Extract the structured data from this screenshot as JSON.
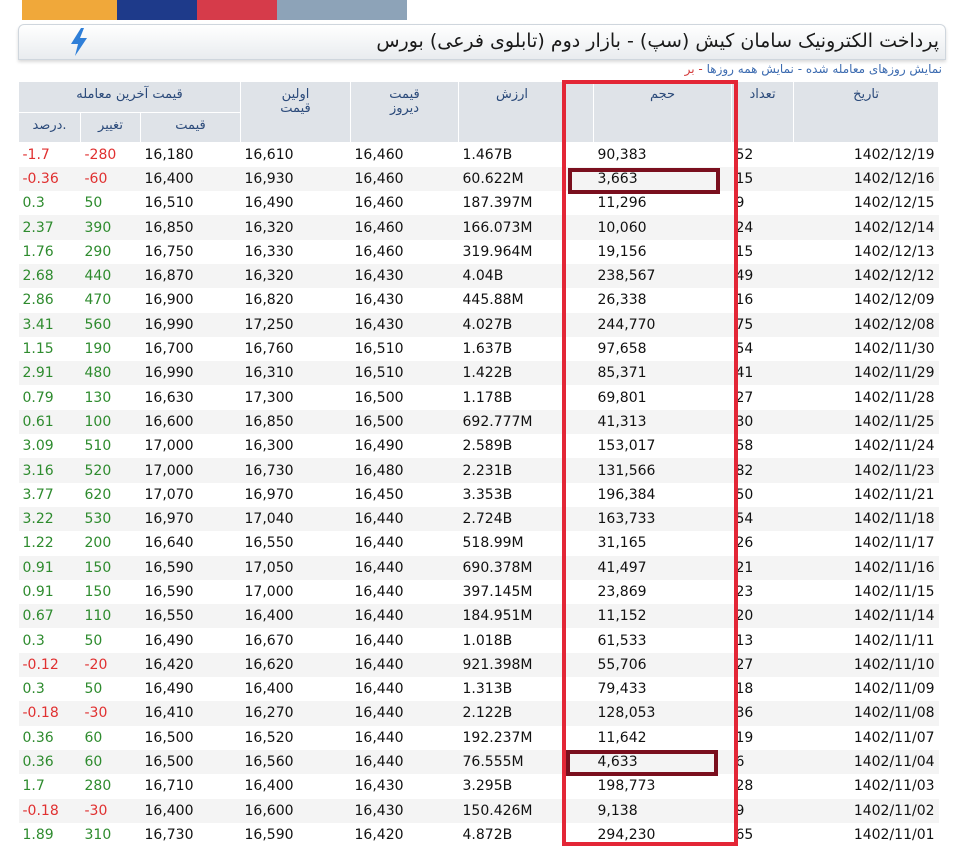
{
  "title": "پرداخت الکترونیک سامان کیش (سپ) - بازار دوم (تابلوی فرعی) بورس",
  "links": {
    "trade_days": "نمایش روزهای معامله شده",
    "separator": "-",
    "all_days": "نمایش همه روزها",
    "cut": "- بر"
  },
  "headers": {
    "date": "تاریخ",
    "count": "تعداد",
    "volume": "حجم",
    "value": "ارزش",
    "yesterday": "قیمت دیروز",
    "first": "اولین قیمت",
    "last_trade": "قیمت آخرین معامله",
    "price": "قیمت",
    "change": "تغییر",
    "percent": "درصد."
  },
  "colors": {
    "positive": "#2e8b2e",
    "negative": "#e03030",
    "highlight_frame": "#e32636",
    "highlight_box": "#7a0f1e"
  },
  "rows": [
    {
      "pct": "-1.7",
      "chg": "-280",
      "price": "16,180",
      "first": "16,610",
      "yest": "16,460",
      "val": "1.467B",
      "vol": "90,383",
      "cnt": "52",
      "date": "1402/12/19"
    },
    {
      "pct": "-0.36",
      "chg": "-60",
      "price": "16,400",
      "first": "16,930",
      "yest": "16,460",
      "val": "60.622M",
      "vol": "3,663",
      "cnt": "15",
      "date": "1402/12/16"
    },
    {
      "pct": "0.3",
      "chg": "50",
      "price": "16,510",
      "first": "16,490",
      "yest": "16,460",
      "val": "187.397M",
      "vol": "11,296",
      "cnt": "9",
      "date": "1402/12/15"
    },
    {
      "pct": "2.37",
      "chg": "390",
      "price": "16,850",
      "first": "16,320",
      "yest": "16,460",
      "val": "166.073M",
      "vol": "10,060",
      "cnt": "24",
      "date": "1402/12/14"
    },
    {
      "pct": "1.76",
      "chg": "290",
      "price": "16,750",
      "first": "16,330",
      "yest": "16,460",
      "val": "319.964M",
      "vol": "19,156",
      "cnt": "15",
      "date": "1402/12/13"
    },
    {
      "pct": "2.68",
      "chg": "440",
      "price": "16,870",
      "first": "16,320",
      "yest": "16,430",
      "val": "4.04B",
      "vol": "238,567",
      "cnt": "49",
      "date": "1402/12/12"
    },
    {
      "pct": "2.86",
      "chg": "470",
      "price": "16,900",
      "first": "16,820",
      "yest": "16,430",
      "val": "445.88M",
      "vol": "26,338",
      "cnt": "16",
      "date": "1402/12/09"
    },
    {
      "pct": "3.41",
      "chg": "560",
      "price": "16,990",
      "first": "17,250",
      "yest": "16,430",
      "val": "4.027B",
      "vol": "244,770",
      "cnt": "75",
      "date": "1402/12/08"
    },
    {
      "pct": "1.15",
      "chg": "190",
      "price": "16,700",
      "first": "16,760",
      "yest": "16,510",
      "val": "1.637B",
      "vol": "97,658",
      "cnt": "54",
      "date": "1402/11/30"
    },
    {
      "pct": "2.91",
      "chg": "480",
      "price": "16,990",
      "first": "16,310",
      "yest": "16,510",
      "val": "1.422B",
      "vol": "85,371",
      "cnt": "41",
      "date": "1402/11/29"
    },
    {
      "pct": "0.79",
      "chg": "130",
      "price": "16,630",
      "first": "17,300",
      "yest": "16,500",
      "val": "1.178B",
      "vol": "69,801",
      "cnt": "27",
      "date": "1402/11/28"
    },
    {
      "pct": "0.61",
      "chg": "100",
      "price": "16,600",
      "first": "16,850",
      "yest": "16,500",
      "val": "692.777M",
      "vol": "41,313",
      "cnt": "30",
      "date": "1402/11/25"
    },
    {
      "pct": "3.09",
      "chg": "510",
      "price": "17,000",
      "first": "16,300",
      "yest": "16,490",
      "val": "2.589B",
      "vol": "153,017",
      "cnt": "58",
      "date": "1402/11/24"
    },
    {
      "pct": "3.16",
      "chg": "520",
      "price": "17,000",
      "first": "16,730",
      "yest": "16,480",
      "val": "2.231B",
      "vol": "131,566",
      "cnt": "82",
      "date": "1402/11/23"
    },
    {
      "pct": "3.77",
      "chg": "620",
      "price": "17,070",
      "first": "16,970",
      "yest": "16,450",
      "val": "3.353B",
      "vol": "196,384",
      "cnt": "50",
      "date": "1402/11/21"
    },
    {
      "pct": "3.22",
      "chg": "530",
      "price": "16,970",
      "first": "17,040",
      "yest": "16,440",
      "val": "2.724B",
      "vol": "163,733",
      "cnt": "54",
      "date": "1402/11/18"
    },
    {
      "pct": "1.22",
      "chg": "200",
      "price": "16,640",
      "first": "16,550",
      "yest": "16,440",
      "val": "518.99M",
      "vol": "31,165",
      "cnt": "26",
      "date": "1402/11/17"
    },
    {
      "pct": "0.91",
      "chg": "150",
      "price": "16,590",
      "first": "17,050",
      "yest": "16,440",
      "val": "690.378M",
      "vol": "41,497",
      "cnt": "21",
      "date": "1402/11/16"
    },
    {
      "pct": "0.91",
      "chg": "150",
      "price": "16,590",
      "first": "17,000",
      "yest": "16,440",
      "val": "397.145M",
      "vol": "23,869",
      "cnt": "23",
      "date": "1402/11/15"
    },
    {
      "pct": "0.67",
      "chg": "110",
      "price": "16,550",
      "first": "16,400",
      "yest": "16,440",
      "val": "184.951M",
      "vol": "11,152",
      "cnt": "20",
      "date": "1402/11/14"
    },
    {
      "pct": "0.3",
      "chg": "50",
      "price": "16,490",
      "first": "16,670",
      "yest": "16,440",
      "val": "1.018B",
      "vol": "61,533",
      "cnt": "13",
      "date": "1402/11/11"
    },
    {
      "pct": "-0.12",
      "chg": "-20",
      "price": "16,420",
      "first": "16,620",
      "yest": "16,440",
      "val": "921.398M",
      "vol": "55,706",
      "cnt": "27",
      "date": "1402/11/10"
    },
    {
      "pct": "0.3",
      "chg": "50",
      "price": "16,490",
      "first": "16,400",
      "yest": "16,440",
      "val": "1.313B",
      "vol": "79,433",
      "cnt": "18",
      "date": "1402/11/09"
    },
    {
      "pct": "-0.18",
      "chg": "-30",
      "price": "16,410",
      "first": "16,270",
      "yest": "16,440",
      "val": "2.122B",
      "vol": "128,053",
      "cnt": "36",
      "date": "1402/11/08"
    },
    {
      "pct": "0.36",
      "chg": "60",
      "price": "16,500",
      "first": "16,520",
      "yest": "16,440",
      "val": "192.237M",
      "vol": "11,642",
      "cnt": "19",
      "date": "1402/11/07"
    },
    {
      "pct": "0.36",
      "chg": "60",
      "price": "16,500",
      "first": "16,560",
      "yest": "16,440",
      "val": "76.555M",
      "vol": "4,633",
      "cnt": "6",
      "date": "1402/11/04"
    },
    {
      "pct": "1.7",
      "chg": "280",
      "price": "16,710",
      "first": "16,400",
      "yest": "16,430",
      "val": "3.295B",
      "vol": "198,773",
      "cnt": "28",
      "date": "1402/11/03"
    },
    {
      "pct": "-0.18",
      "chg": "-30",
      "price": "16,400",
      "first": "16,600",
      "yest": "16,430",
      "val": "150.426M",
      "vol": "9,138",
      "cnt": "9",
      "date": "1402/11/02"
    },
    {
      "pct": "1.89",
      "chg": "310",
      "price": "16,730",
      "first": "16,590",
      "yest": "16,420",
      "val": "4.872B",
      "vol": "294,230",
      "cnt": "65",
      "date": "1402/11/01"
    }
  ]
}
